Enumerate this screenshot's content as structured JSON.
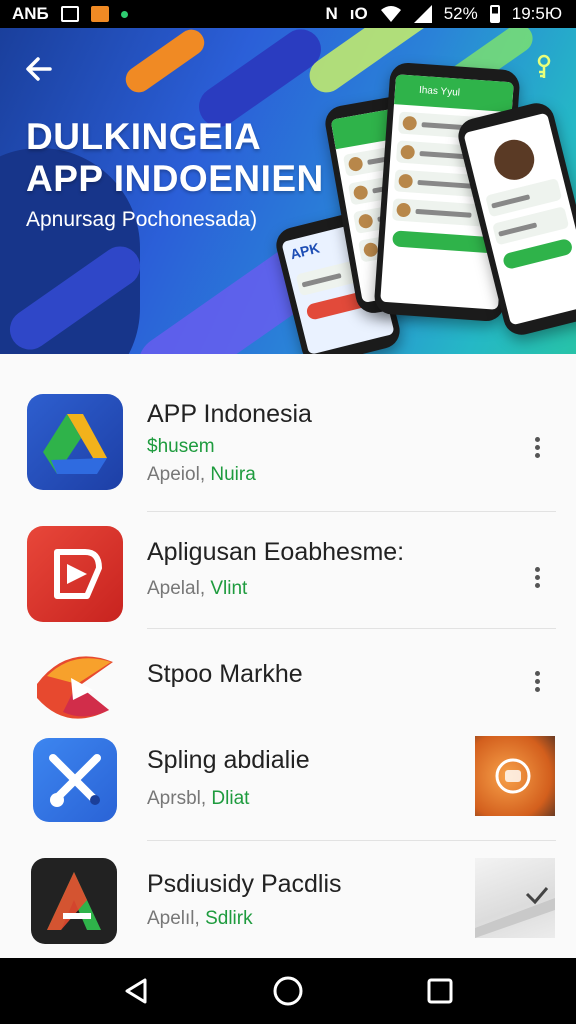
{
  "status_bar": {
    "carrier": "ANБ",
    "battery_percent": "52%",
    "time": "19:5Ю",
    "icons": [
      "image-icon",
      "app-notification-icon",
      "dot-icon",
      "nfc-icon",
      "vibrate-icon",
      "wifi-icon",
      "signal-icon",
      "battery-icon"
    ]
  },
  "banner": {
    "title_line1": "DULKINGEIA",
    "title_line2": "APP INDOENIEN",
    "subtitle": "Apnursag Pochonesada)",
    "phone_header": "Ihas Yyul",
    "phone_badge": "APK",
    "colors": {
      "accent_green": "#2fb34a",
      "banner_blue": "#2b5fd8",
      "banner_teal": "#27c3a8"
    }
  },
  "apps": [
    {
      "name": "APP Indonesia",
      "price": "$husem",
      "meta_prefix": "Apeiol, ",
      "meta_highlight": "Nuira",
      "icon": "drive-triangle-icon",
      "has_menu": true
    },
    {
      "name": "Apligusan Eoabhesme:",
      "meta_prefix": "Apelal, ",
      "meta_highlight": "Vlint",
      "icon": "play-shield-icon",
      "has_menu": true
    },
    {
      "name": "Stpoo Markhe",
      "icon": "paper-plane-icon",
      "has_menu": true
    },
    {
      "name": "Spling abdialie",
      "meta_prefix": "Aprsbl, ",
      "meta_highlight": "Dliat",
      "icon": "tools-cross-icon",
      "has_menu": false,
      "thumb": "orange-promo-thumbnail"
    },
    {
      "name": "Psdiusidy Pacdlis",
      "meta_prefix": "Apelıl, ",
      "meta_highlight": "Sdlirk",
      "icon": "letter-a-icon",
      "has_menu": false,
      "thumb": "road-promo-thumbnail"
    }
  ],
  "navbar": {
    "icons": [
      "back-triangle-icon",
      "home-circle-icon",
      "recents-square-icon"
    ]
  }
}
